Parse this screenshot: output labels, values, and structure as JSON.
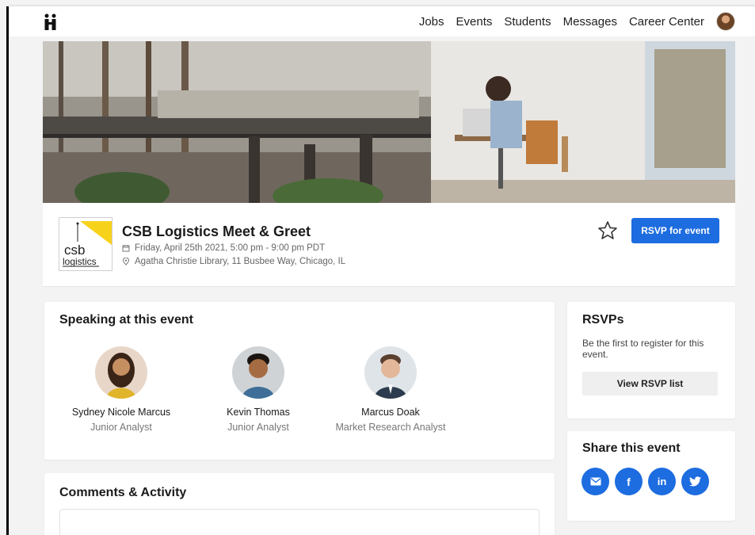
{
  "nav": {
    "links": [
      "Jobs",
      "Events",
      "Students",
      "Messages",
      "Career Center"
    ]
  },
  "event": {
    "title": "CSB Logistics Meet & Greet",
    "date": "Friday, April 25th 2021, 5:00 pm - 9:00 pm PDT",
    "location": "Agatha Christie Library, 11 Busbee Way, Chicago, IL",
    "rsvp_button": "RSVP for event",
    "org_logo": {
      "line1": "csb",
      "line2": "logistics",
      "accent_color": "#f7d21b"
    }
  },
  "speakers": {
    "heading": "Speaking at this event",
    "items": [
      {
        "name": "Sydney Nicole Marcus",
        "role": "Junior Analyst"
      },
      {
        "name": "Kevin Thomas",
        "role": "Junior Analyst"
      },
      {
        "name": "Marcus Doak",
        "role": "Market Research Analyst"
      }
    ]
  },
  "comments": {
    "heading": "Comments & Activity"
  },
  "rsvps": {
    "heading": "RSVPs",
    "text": "Be the first to register for this event.",
    "button": "View RSVP list"
  },
  "share": {
    "heading": "Share this event",
    "icons": [
      {
        "icon": "email-icon",
        "glyph": "✉"
      },
      {
        "icon": "facebook-icon",
        "glyph": "f"
      },
      {
        "icon": "linkedin-icon",
        "glyph": "in"
      },
      {
        "icon": "twitter-icon",
        "glyph": "🐦"
      }
    ]
  },
  "colors": {
    "accent": "#1d6ce0",
    "background": "#f3f3f3"
  }
}
